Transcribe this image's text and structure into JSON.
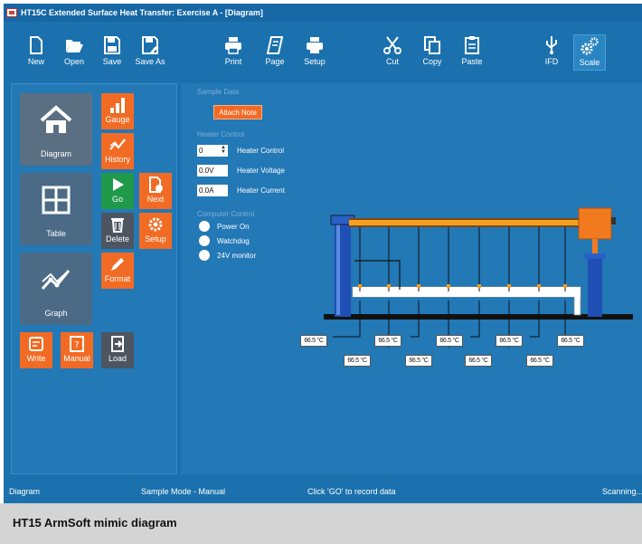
{
  "window": {
    "title": "HT15C Extended Surface Heat Transfer: Exercise A - [Diagram]"
  },
  "toolbar": {
    "new": "New",
    "open": "Open",
    "save": "Save",
    "save_as": "Save As",
    "print": "Print",
    "page": "Page",
    "setup": "Setup",
    "cut": "Cut",
    "copy": "Copy",
    "paste": "Paste",
    "ifd": "IFD",
    "scale": "Scale"
  },
  "nav": {
    "diagram": "Diagram",
    "table": "Table",
    "graph": "Graph",
    "gauge": "Gauge",
    "history": "History",
    "go": "Go",
    "next": "Next",
    "delete": "Delete",
    "setup": "Setup",
    "format": "Format",
    "write": "Write",
    "manual": "Manual",
    "load": "Load"
  },
  "sample_data": {
    "heading": "Sample Data",
    "attach_note": "Attach Note"
  },
  "heater_control": {
    "heading": "Heater Control",
    "control_value": "0",
    "control_label": "Heater Control",
    "voltage_value": "0.0V",
    "voltage_label": "Heater Voltage",
    "current_value": "0.0A",
    "current_label": "Heater Current"
  },
  "computer_control": {
    "heading": "Computer Control",
    "items": [
      "Power On",
      "Watchdog",
      "24V monitor"
    ]
  },
  "temperatures": {
    "upper": [
      "66.5 °C",
      "66.5 °C",
      "66.5 °C",
      "66.5 °C",
      "66.5 °C"
    ],
    "lower": [
      "66.5 °C",
      "66.5 °C",
      "66.5 °C",
      "66.5 °C"
    ]
  },
  "status": {
    "view": "Diagram",
    "mode": "Sample Mode - Manual",
    "hint": "Click 'GO' to record data",
    "state": "Scanning..."
  },
  "caption": "HT15 ArmSoft mimic diagram",
  "colors": {
    "accent_orange": "#f26b24",
    "go_green": "#1f9a4a",
    "app_blue": "#1b71ad"
  }
}
